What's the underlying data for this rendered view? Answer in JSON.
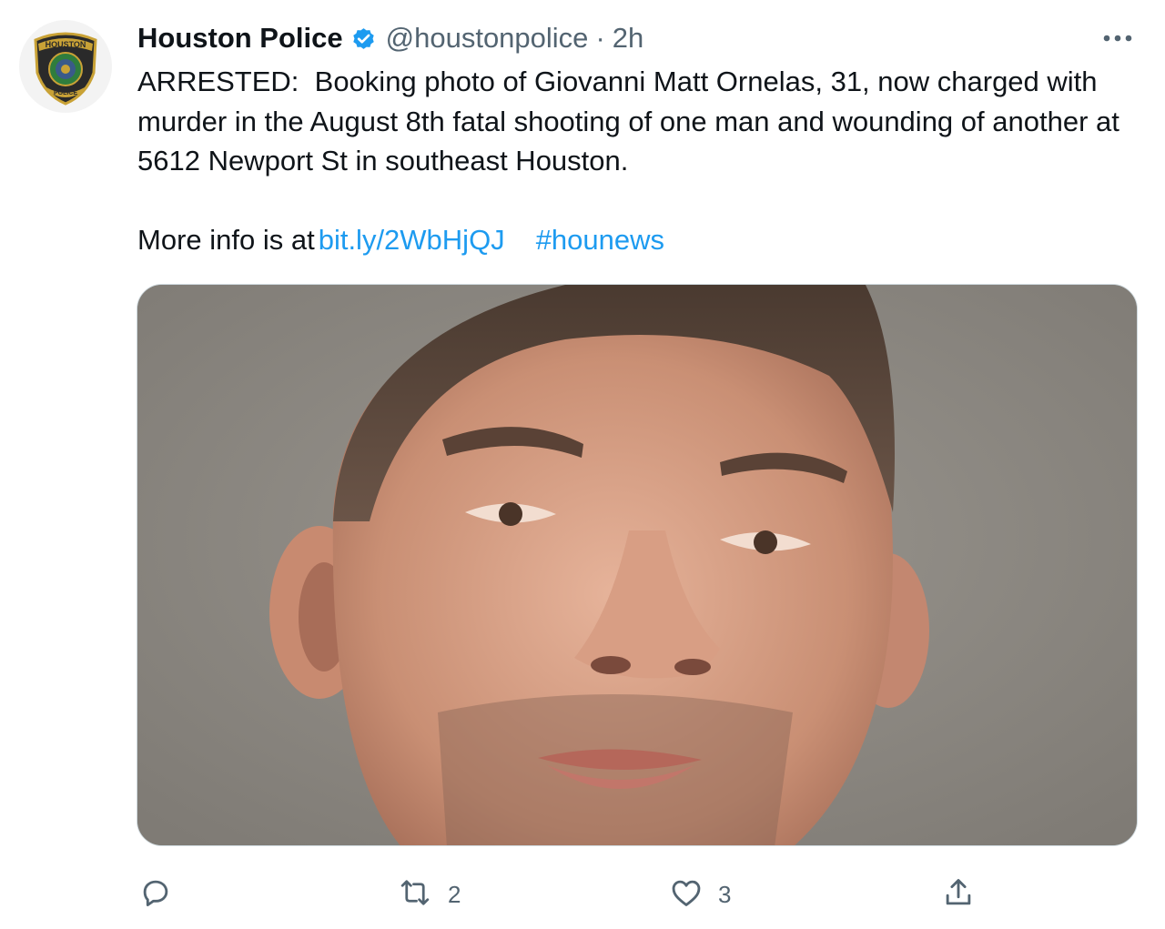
{
  "tweet": {
    "author_name": "Houston Police",
    "handle": "@houstonpolice",
    "separator": "·",
    "time": "2h",
    "text": "ARRESTED:  Booking photo of Giovanni Matt Ornelas, 31, now charged with murder in the August 8th fatal shooting of one man and wounding of another at 5612 Newport St in southeast Houston.",
    "more_info_prefix": "More info is at",
    "link": "bit.ly/2WbHjQJ",
    "hashtag": "#hounews",
    "avatar_badge_top": "HOUSTON",
    "avatar_badge_bottom": "POLICE"
  },
  "actions": {
    "reply_count": "",
    "retweet_count": "2",
    "like_count": "3"
  },
  "icons": {
    "verified": "verified-badge-icon",
    "more": "more-options-icon",
    "reply": "reply-icon",
    "retweet": "retweet-icon",
    "like": "heart-icon",
    "share": "share-icon"
  },
  "colors": {
    "accent": "#1d9bf0",
    "secondary_text": "#536471",
    "primary_text": "#0f1419",
    "border": "#cfd9de"
  }
}
